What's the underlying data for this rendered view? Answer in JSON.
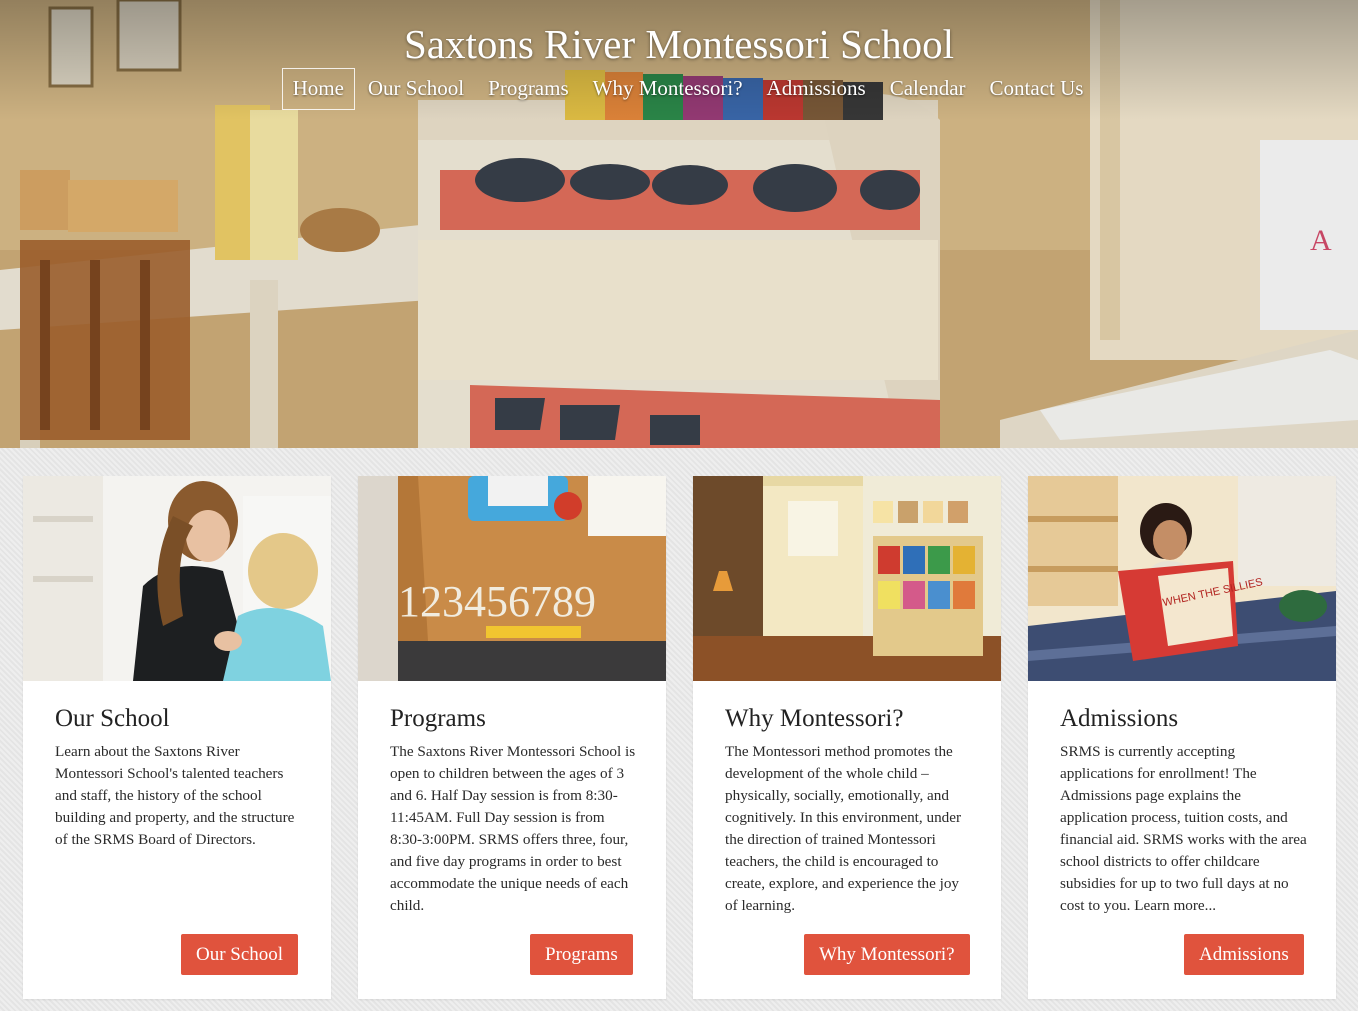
{
  "site": {
    "title": "Saxtons River Montessori School"
  },
  "nav": {
    "items": [
      {
        "label": "Home",
        "active": true
      },
      {
        "label": "Our School"
      },
      {
        "label": "Programs"
      },
      {
        "label": "Why Montessori?"
      },
      {
        "label": "Admissions"
      },
      {
        "label": "Calendar"
      },
      {
        "label": "Contact Us"
      }
    ]
  },
  "hero": {
    "photo_text": "123456789",
    "book_text": "WHEN THE SILLIES"
  },
  "colors": {
    "button": "#e0533d",
    "page_background": "#e9e9e9",
    "card_background": "#ffffff"
  },
  "cards": [
    {
      "title": "Our School",
      "text": "Learn about the Saxtons River Montessori School's talented teachers and staff, the history of the school building and property, and the structure of the SRMS Board of Directors.",
      "button": "Our School"
    },
    {
      "title": "Programs",
      "text": "The Saxtons River Montessori School is open to children between the ages of 3 and 6. Half Day session is from 8:30-11:45AM. Full Day session is from 8:30-3:00PM. SRMS offers three, four, and five day programs in order to best accommodate the unique needs of each child.",
      "button": "Programs"
    },
    {
      "title": "Why Montessori?",
      "text": "The Montessori method promotes the development of the whole child – physically, socially, emotionally, and cognitively. In this environment, under the direction of trained Montessori teachers, the child is encouraged to create, explore, and experience the joy of learning.",
      "button": "Why Montessori?"
    },
    {
      "title": "Admissions",
      "text": "SRMS is currently accepting applications for enrollment! The Admissions page explains the application process, tuition costs, and financial aid. SRMS works with the area school districts to offer childcare subsidies for up to two full days at no cost to you. Learn more...",
      "button": "Admissions"
    }
  ]
}
